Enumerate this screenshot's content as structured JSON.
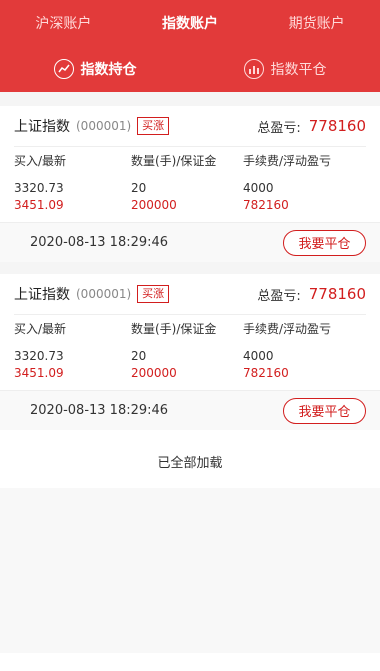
{
  "tabs": [
    "沪深账户",
    "指数账户",
    "期货账户"
  ],
  "subtabs": [
    "指数持仓",
    "指数平仓"
  ],
  "positions": [
    {
      "name": "上证指数",
      "code": "(000001)",
      "badge": "买涨",
      "total_label": "总盈亏:",
      "total_value": "778160",
      "headers": [
        "买入/最新",
        "数量(手)/保证金",
        "手续费/浮动盈亏"
      ],
      "values_row1": [
        "3320.73",
        "20",
        "4000"
      ],
      "values_row2": [
        "3451.09",
        "200000",
        "782160"
      ],
      "time": "2020-08-13 18:29:46",
      "button": "我要平仓"
    },
    {
      "name": "上证指数",
      "code": "(000001)",
      "badge": "买涨",
      "total_label": "总盈亏:",
      "total_value": "778160",
      "headers": [
        "买入/最新",
        "数量(手)/保证金",
        "手续费/浮动盈亏"
      ],
      "values_row1": [
        "3320.73",
        "20",
        "4000"
      ],
      "values_row2": [
        "3451.09",
        "200000",
        "782160"
      ],
      "time": "2020-08-13 18:29:46",
      "button": "我要平仓"
    }
  ],
  "footer": "已全部加载",
  "colors": {
    "primary": "#e23a3a",
    "accent": "#d21e1e"
  }
}
